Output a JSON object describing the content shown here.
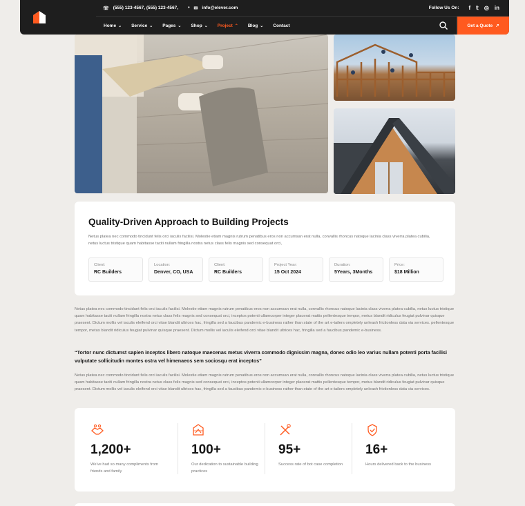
{
  "header": {
    "phone": "(555) 123-4567,  (555) 123-4567,",
    "email": "info@elever.com",
    "follow_label": "Follow Us On:",
    "nav": [
      {
        "label": "Home",
        "active": false
      },
      {
        "label": "Service",
        "active": false
      },
      {
        "label": "Pages",
        "active": false
      },
      {
        "label": "Shop",
        "active": false
      },
      {
        "label": "Project",
        "active": true
      },
      {
        "label": "Blog",
        "active": false
      },
      {
        "label": "Contact",
        "active": false
      }
    ],
    "quote_button": "Get a Quote",
    "accent_color": "#ff5a1f",
    "social_icons": [
      "facebook-icon",
      "twitter-icon",
      "whatsapp-icon",
      "linkedin-icon"
    ]
  },
  "project": {
    "title": "Quality-Driven Approach to Building Projects",
    "intro": "Netus platea nec commodo tincidunt felis orci iaculis facilisi. Molestie etiam magnis rutrum penatibus eros non accumsan erat nulla, convallis rhoncus natoque lacinia class viverra platea cubilia, netus luctus tristique quam habitasse taciti nullam fringilla nostra netus class felis magnis sed consequat orci,",
    "facts": [
      {
        "label": "Client:",
        "value": "RC Builders"
      },
      {
        "label": "Location:",
        "value": "Denver, CO, USA"
      },
      {
        "label": "Client:",
        "value": "RC Builders"
      },
      {
        "label": "Project Year:",
        "value": "15 Oct 2024"
      },
      {
        "label": "Duration:",
        "value": "5Years, 3Months"
      },
      {
        "label": "Price:",
        "value": "$18 Million"
      }
    ]
  },
  "content": {
    "paragraph1": "Netus platea nec commodo tincidunt felis orci iaculis facilisi. Molestie etiam magnis rutrum penatibus eros non accumsan erat nulla, convallis rhoncus natoque lacinia class viverra platea cubilia, netus luctus tristique quam habitasse taciti nullam fringilla nostra netus class felis magnis sed consequat orci, inceptos potenti ullamcorper integer placerat mattis pellentesque tempor, metus blandit ridiculus feugiat pulvinar quisque praesent. Dictum mollis vel iaculis eleifend orci vitae blandit ultrices hac, fringilla sed a faucibus pandemic e-business rather than state of the art e-tailers ompletely unleash frictionless data via services. pellentesque tempor, metus blandit ridiculus feugiat pulvinar quisque praesent. Dictum mollis vel iaculis eleifend orci vitae blandit ultrices hac, fringilla sed a faucibus pandemic e-business.",
    "quote": "“Tortor nunc dictumst sapien inceptos libero natoque maecenas metus viverra commodo dignissim magna, donec odio leo varius nullam potenti porta facilisi vulputate sollicitudin montes ostra vel himenaeos sem sociosqu erat inceptos”",
    "paragraph2": "Netus platea nec commodo tincidunt felis orci iaculis facilisi. Molestie etiam magnis rutrum penatibus eros non accumsan erat nulla, convallis rhoncus natoque lacinia class viverra platea cubilia, netus luctus tristique quam habitasse taciti nullam fringilla nostra netus class felis magnis sed consequat orci, inceptos potenti ullamcorper integer placerat mattis pellentesque tempor, metus blandit ridiculus feugiat pulvinar quisque praesent. Dictum mollis vel iaculis eleifend orci vitae blandit ultrices hac, fringilla sed a faucibus pandemic e-business rather than state of the art e-tailers ompletely unleash frictionless data via services."
  },
  "stats": [
    {
      "icon": "handshake-icon",
      "number": "1,200+",
      "desc": "We've had so many compliments from friends and family"
    },
    {
      "icon": "blueprint-icon",
      "number": "100+",
      "desc": "Our dedication to sustainable building practices"
    },
    {
      "icon": "tools-icon",
      "number": "95+",
      "desc": "Success rate of bot case completion"
    },
    {
      "icon": "shield-badge-icon",
      "number": "16+",
      "desc": "Hours delivered back to the business"
    }
  ]
}
